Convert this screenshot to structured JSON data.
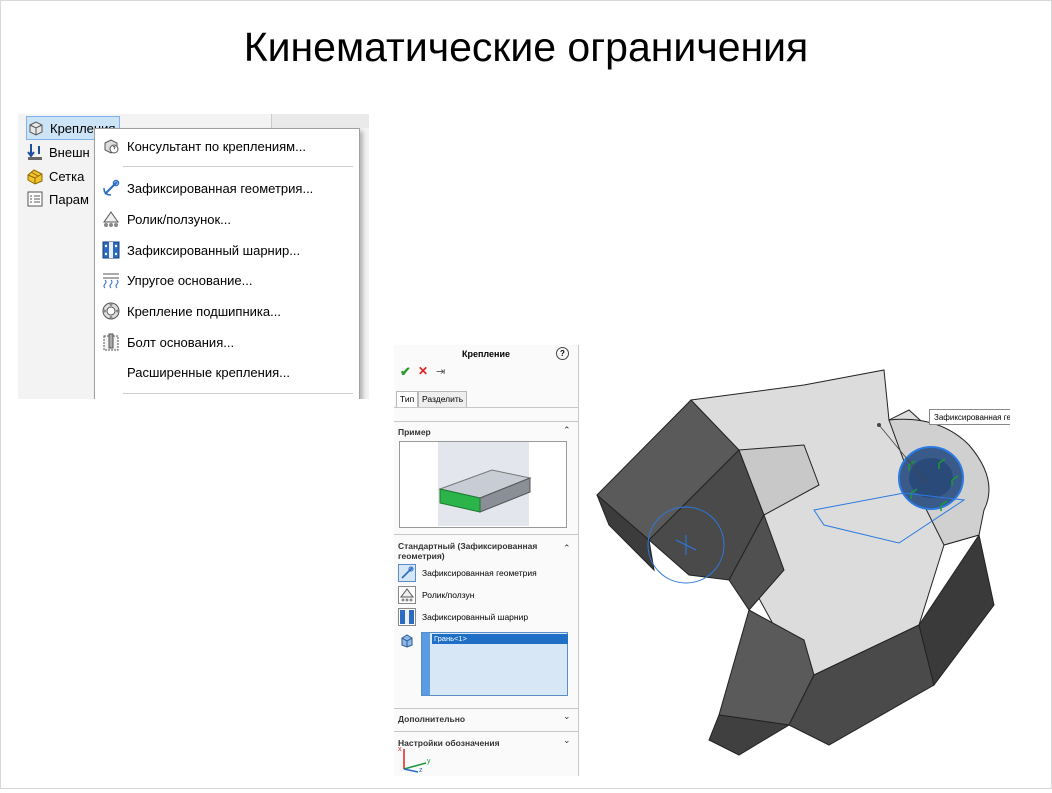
{
  "slide": {
    "title": "Кинематические ограничения"
  },
  "menu_screenshot": {
    "tree_items": [
      {
        "label": "Крепления",
        "icon": "fixtures-icon",
        "selected": true
      },
      {
        "label": "Внешн",
        "icon": "external-loads-icon",
        "selected": false
      },
      {
        "label": "Сетка",
        "icon": "mesh-icon",
        "selected": false
      },
      {
        "label": "Парам",
        "icon": "parameters-icon",
        "selected": false
      }
    ],
    "dropdown_items": [
      {
        "label": "Консультант по креплениям...",
        "icon": "fixture-advisor-icon"
      },
      {
        "label": "Зафиксированная геометрия...",
        "icon": "fixed-geometry-icon"
      },
      {
        "label": "Ролик/ползунок...",
        "icon": "roller-slider-icon"
      },
      {
        "label": "Зафиксированный шарнир...",
        "icon": "fixed-hinge-icon"
      },
      {
        "label": "Упругое основание...",
        "icon": "elastic-support-icon"
      },
      {
        "label": "Крепление подшипника...",
        "icon": "bearing-fixture-icon"
      },
      {
        "label": "Болт основания...",
        "icon": "foundation-bolt-icon"
      },
      {
        "label": "Расширенные крепления...",
        "icon": ""
      }
    ]
  },
  "property_manager": {
    "title": "Крепление",
    "help_glyph": "?",
    "ok_glyph": "✔",
    "cancel_glyph": "✕",
    "pin_glyph": "⇥",
    "tabs": [
      {
        "label": "Тип",
        "active": true
      },
      {
        "label": "Разделить",
        "active": false
      }
    ],
    "sections": {
      "example": "Пример",
      "standard": "Стандартный (Зафиксированная геометрия)",
      "advanced": "Дополнительно",
      "symbol_settings": "Настройки обозначения"
    },
    "standard_options": [
      {
        "label": "Зафиксированная геометрия",
        "icon": "fixed-geometry-icon",
        "selected": true
      },
      {
        "label": "Ролик/ползун",
        "icon": "roller-slider-icon",
        "selected": false
      },
      {
        "label": "Зафиксированный шарнир",
        "icon": "fixed-hinge-icon",
        "selected": false
      }
    ],
    "selection_list": [
      "Грань<1>"
    ],
    "chevron_up": "⌃",
    "chevron_down": "⌄"
  },
  "viewport": {
    "callout_label": "Зафиксированная геометрия:",
    "accent_color": "#2a7ae2",
    "fixture_color": "#1a9a3a",
    "triad_labels": {
      "x": "x",
      "y": "y",
      "z": "z"
    }
  }
}
